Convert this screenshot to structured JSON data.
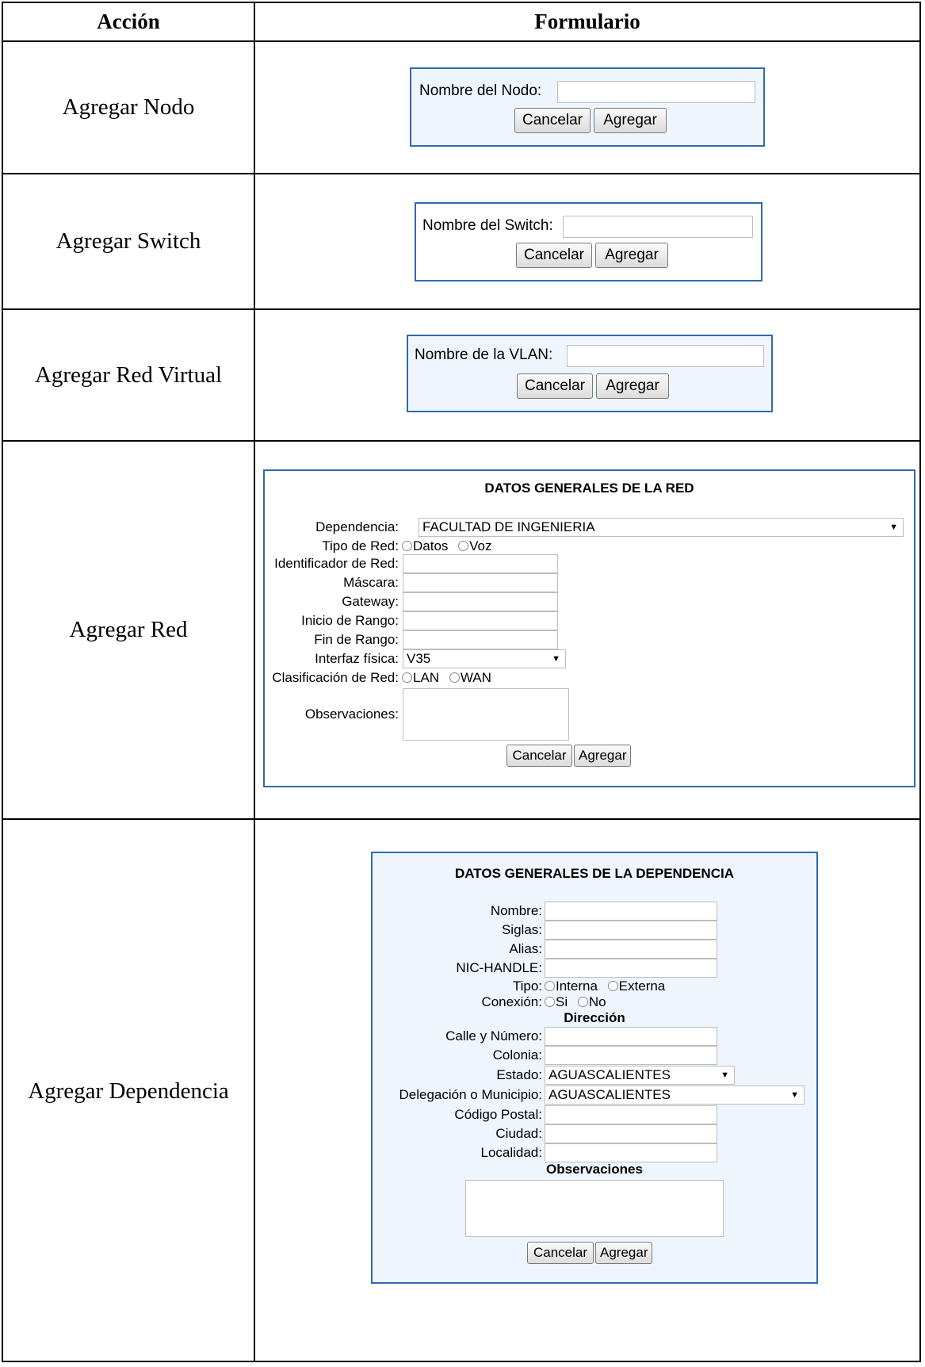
{
  "headers": {
    "accion": "Acción",
    "formulario": "Formulario"
  },
  "rows": [
    {
      "action": "Agregar Nodo",
      "form": {
        "label": "Nombre del Nodo:",
        "cancel": "Cancelar",
        "add": "Agregar"
      }
    },
    {
      "action": "Agregar Switch",
      "form": {
        "label": "Nombre del Switch:",
        "cancel": "Cancelar",
        "add": "Agregar"
      }
    },
    {
      "action": "Agregar Red Virtual",
      "form": {
        "label": "Nombre de la VLAN:",
        "cancel": "Cancelar",
        "add": "Agregar"
      }
    },
    {
      "action": "Agregar Red",
      "form": {
        "title": "DATOS GENERALES DE LA RED",
        "dependencia_label": "Dependencia:",
        "dependencia_value": "FACULTAD DE INGENIERIA",
        "tipo_label": "Tipo de Red:",
        "tipo_options": [
          "Datos",
          "Voz"
        ],
        "identificador_label": "Identificador de Red:",
        "mascara_label": "Máscara:",
        "gateway_label": "Gateway:",
        "inicio_label": "Inicio de Rango:",
        "fin_label": "Fin de Rango:",
        "interfaz_label": "Interfaz física:",
        "interfaz_value": "V35",
        "clasificacion_label": "Clasificación de Red:",
        "clasificacion_options": [
          "LAN",
          "WAN"
        ],
        "observaciones_label": "Observaciones:",
        "cancel": "Cancelar",
        "add": "Agregar"
      }
    },
    {
      "action": "Agregar Dependencia",
      "form": {
        "title": "DATOS GENERALES DE LA DEPENDENCIA",
        "nombre_label": "Nombre:",
        "siglas_label": "Siglas:",
        "alias_label": "Alias:",
        "nic_label": "NIC-HANDLE:",
        "tipo_label": "Tipo:",
        "tipo_options": [
          "Interna",
          "Externa"
        ],
        "conexion_label": "Conexión:",
        "conexion_options": [
          "Si",
          "No"
        ],
        "direccion_title": "Dirección",
        "calle_label": "Calle y Número:",
        "colonia_label": "Colonia:",
        "estado_label": "Estado:",
        "estado_value": "AGUASCALIENTES",
        "delegacion_label": "Delegación o Municipio:",
        "delegacion_value": "AGUASCALIENTES",
        "cp_label": "Código Postal:",
        "ciudad_label": "Ciudad:",
        "localidad_label": "Localidad:",
        "observaciones_title": "Observaciones",
        "cancel": "Cancelar",
        "add": "Agregar"
      }
    }
  ]
}
